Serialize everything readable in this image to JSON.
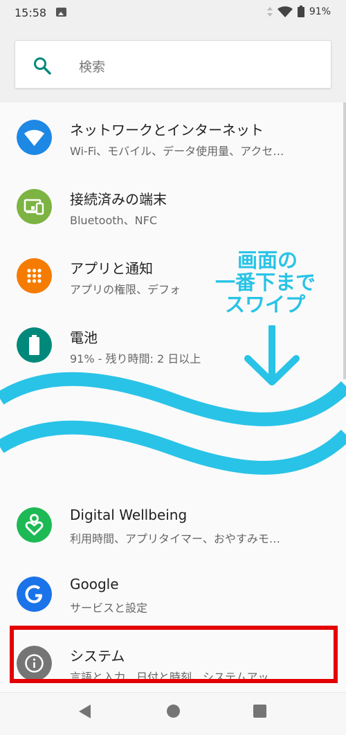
{
  "status_bar": {
    "time": "15:58",
    "battery": "91%"
  },
  "search": {
    "placeholder": "検索"
  },
  "settings_items": [
    {
      "title": "ネットワークとインターネット",
      "subtitle": "Wi-Fi、モバイル、データ使用量、アクセ…",
      "icon": "wifi-icon",
      "color": "#1e88e5"
    },
    {
      "title": "接続済みの端末",
      "subtitle": "Bluetooth、NFC",
      "icon": "connected-devices-icon",
      "color": "#7cb342"
    },
    {
      "title": "アプリと通知",
      "subtitle": "アプリの権限、デフォ",
      "icon": "apps-icon",
      "color": "#f57c00"
    },
    {
      "title": "電池",
      "subtitle": "91% - 残り時間: 2 日以上",
      "icon": "battery-icon",
      "color": "#00897b"
    },
    {
      "title": "Digital Wellbeing",
      "subtitle": "利用時間、アプリタイマー、おやすみモ…",
      "icon": "digital-wellbeing-icon",
      "color": "#1db954"
    },
    {
      "title": "Google",
      "subtitle": "サービスと設定",
      "icon": "google-icon",
      "color": "#1a73e8"
    },
    {
      "title": "システム",
      "subtitle": "言語と入力、日付と時刻、システムアッ…",
      "icon": "info-icon",
      "color": "#757575"
    }
  ],
  "overlay": {
    "lines": [
      "画面の",
      "一番下まで",
      "スワイプ"
    ],
    "color": "#29c3e7"
  },
  "highlight_color": "#e30000"
}
